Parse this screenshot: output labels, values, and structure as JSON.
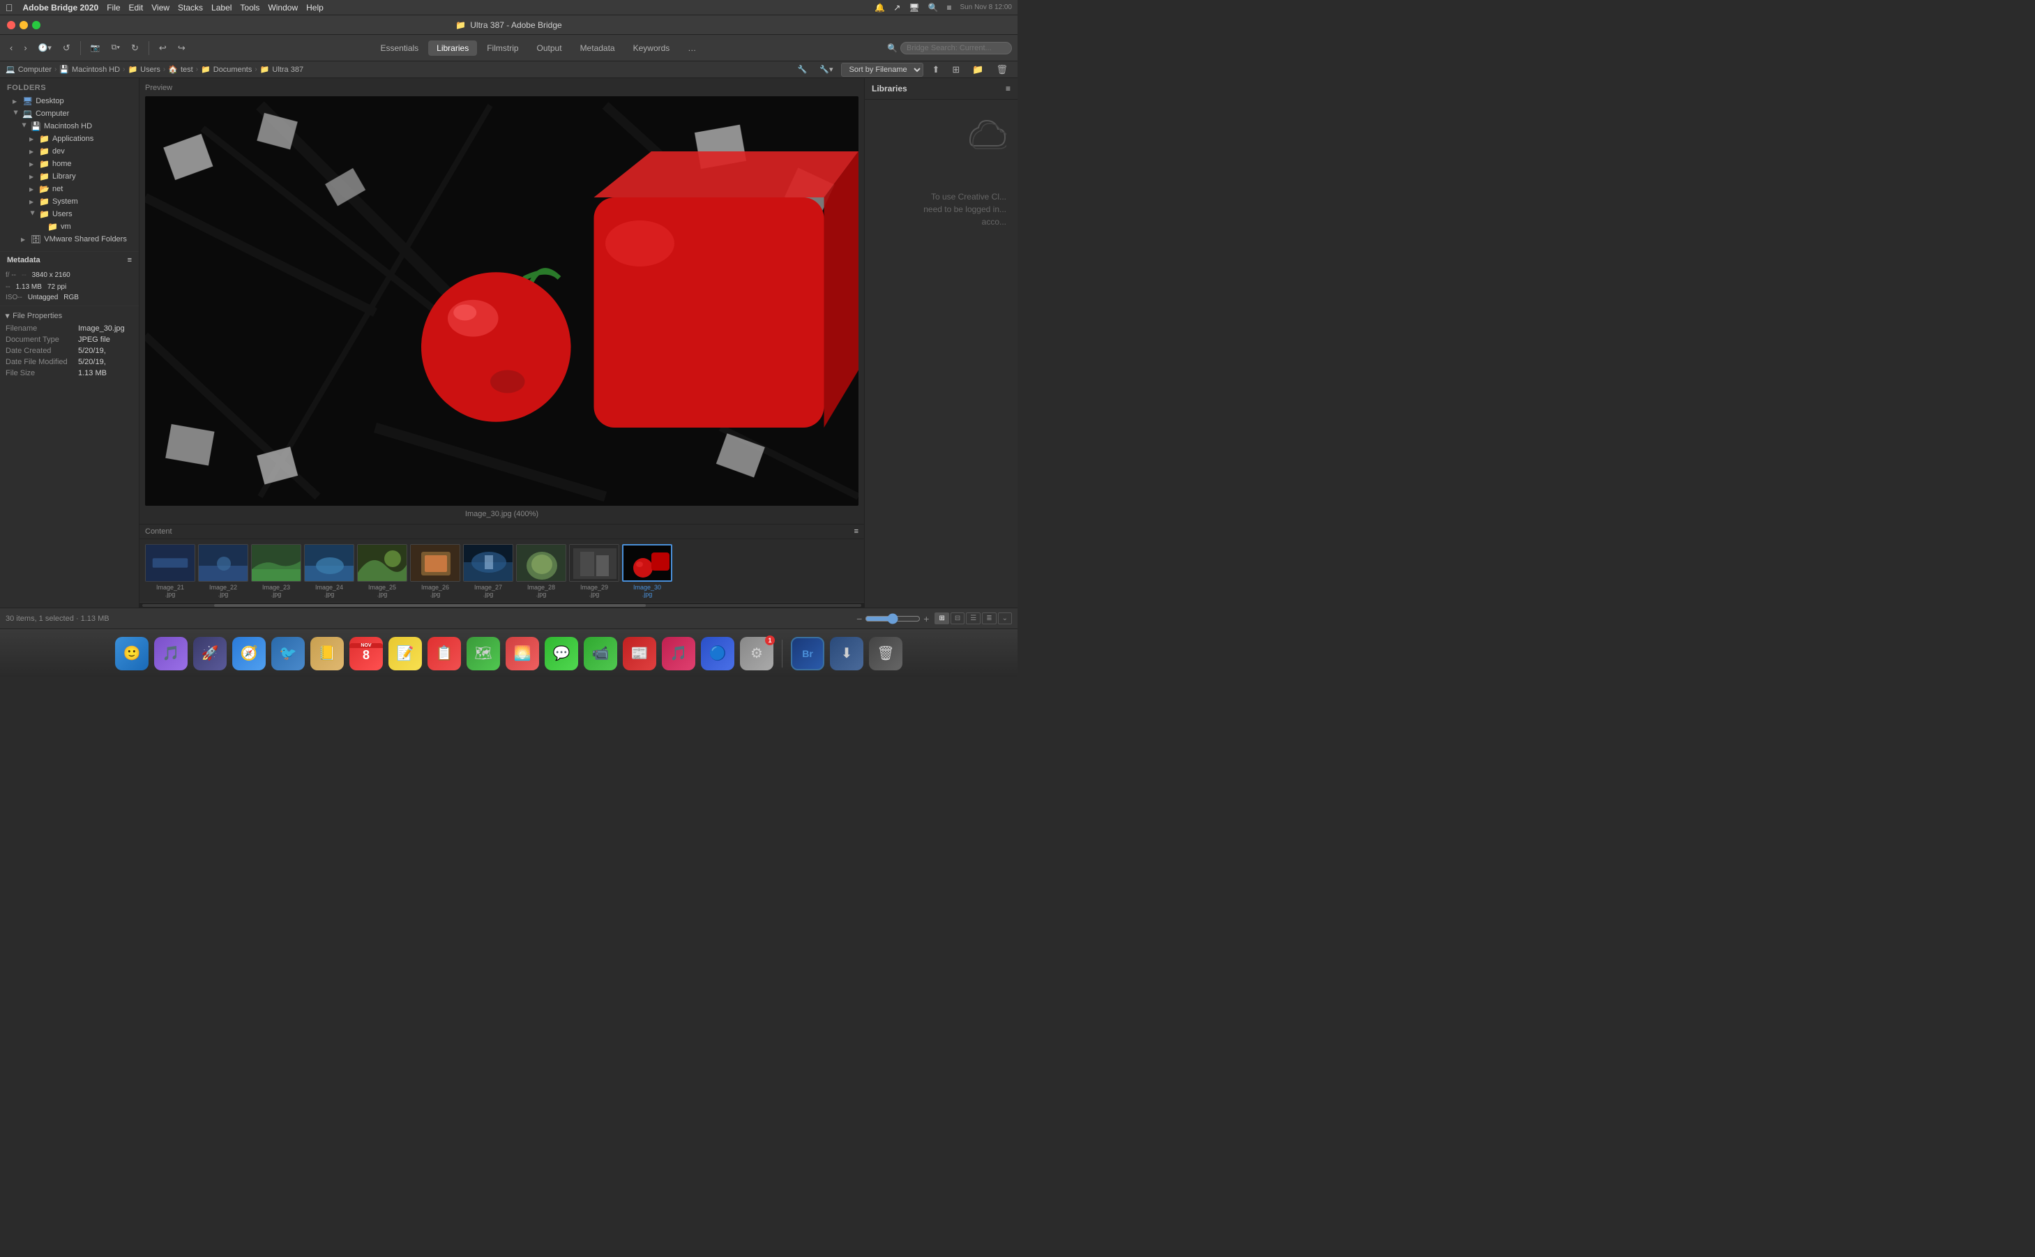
{
  "menubar": {
    "apple": "&#xf8ff;",
    "items": [
      "Adobe Bridge 2020",
      "File",
      "Edit",
      "View",
      "Stacks",
      "Label",
      "Tools",
      "Window",
      "Help"
    ],
    "right_icons": [
      "notification",
      "share",
      "display",
      "search",
      "menu"
    ]
  },
  "titlebar": {
    "title": "Ultra 387 - Adobe Bridge",
    "folder_icon": "📁"
  },
  "toolbar": {
    "back": "‹",
    "forward": "›",
    "history": "🕐",
    "rotate_left": "↺",
    "camera": "📷",
    "copy": "⧉",
    "refresh": "↺",
    "undo": "↩",
    "redo": "↪",
    "nav_tabs": [
      "Essentials",
      "Libraries",
      "Filmstrip",
      "Output",
      "Metadata",
      "Keywords"
    ],
    "active_tab": "Libraries",
    "more_btn": "…",
    "search_placeholder": "Bridge Search: Current..."
  },
  "breadcrumb": {
    "items": [
      {
        "label": "Computer",
        "icon": "💻"
      },
      {
        "label": "Macintosh HD",
        "icon": "💾"
      },
      {
        "label": "Users",
        "icon": "📁"
      },
      {
        "label": "test",
        "icon": "🏠"
      },
      {
        "label": "Documents",
        "icon": "📁"
      },
      {
        "label": "Ultra 387",
        "icon": "📁"
      }
    ],
    "sort_label": "Sort by Filename",
    "sort_icons": [
      "⬆",
      "filter",
      "view1",
      "view2"
    ]
  },
  "sidebar": {
    "section_label": "Folders",
    "tree": [
      {
        "label": "Desktop",
        "icon": "🖥",
        "indent": 1,
        "expanded": false
      },
      {
        "label": "Computer",
        "icon": "💻",
        "indent": 1,
        "expanded": true
      },
      {
        "label": "Macintosh HD",
        "icon": "💾",
        "indent": 2,
        "expanded": true
      },
      {
        "label": "Applications",
        "icon": "📁",
        "indent": 3,
        "expanded": false
      },
      {
        "label": "dev",
        "icon": "📁",
        "indent": 3,
        "expanded": false
      },
      {
        "label": "home",
        "icon": "📁",
        "indent": 3,
        "expanded": false
      },
      {
        "label": "Library",
        "icon": "📁",
        "indent": 3,
        "expanded": false
      },
      {
        "label": "net",
        "icon": "📂",
        "indent": 3,
        "expanded": false
      },
      {
        "label": "System",
        "icon": "📁",
        "indent": 3,
        "expanded": false
      },
      {
        "label": "Users",
        "icon": "📁",
        "indent": 3,
        "expanded": true
      },
      {
        "label": "vm",
        "icon": "📁",
        "indent": 4,
        "expanded": false
      },
      {
        "label": "VMware Shared Folders",
        "icon": "🗄",
        "indent": 2,
        "expanded": false
      }
    ]
  },
  "preview": {
    "label": "Preview",
    "caption": "Image_30.jpg (400%)",
    "image_desc": "red cherry and red cube on black background"
  },
  "metadata_panel": {
    "label": "Metadata",
    "aperture": "f/ --",
    "shutter": "--",
    "iso": "ISO--",
    "blank1": "--",
    "dimensions": "3840 x 2160",
    "file_size": "1.13 MB",
    "ppi": "72 ppi",
    "color_profile": "Untagged",
    "color_mode": "RGB",
    "file_properties_label": "File Properties",
    "filename_key": "Filename",
    "filename_val": "Image_30.jpg",
    "doctype_key": "Document Type",
    "doctype_val": "JPEG file",
    "date_created_key": "Date Created",
    "date_created_val": "5/20/19,",
    "date_modified_key": "Date File Modified",
    "date_modified_val": "5/20/19,",
    "filesize_key": "File Size",
    "filesize_val": "1.13 MB"
  },
  "content": {
    "label": "Content",
    "thumbnails": [
      {
        "label": "Image_21\n.jpg",
        "color": "color-1",
        "selected": false
      },
      {
        "label": "Image_22\n.jpg",
        "color": "color-2",
        "selected": false
      },
      {
        "label": "Image_23\n.jpg",
        "color": "color-3",
        "selected": false
      },
      {
        "label": "Image_24\n.jpg",
        "color": "color-4",
        "selected": false
      },
      {
        "label": "Image_25\n.jpg",
        "color": "color-5",
        "selected": false
      },
      {
        "label": "Image_26\n.jpg",
        "color": "color-6",
        "selected": false
      },
      {
        "label": "Image_27\n.jpg",
        "color": "color-7",
        "selected": false
      },
      {
        "label": "Image_28\n.jpg",
        "color": "color-8",
        "selected": false
      },
      {
        "label": "Image_29\n.jpg",
        "color": "color-8",
        "selected": false
      },
      {
        "label": "Image_30\n.jpg",
        "color": "color-9",
        "selected": true
      }
    ]
  },
  "libraries": {
    "label": "Libraries",
    "message": "To use Creative Cl...\nneed to be logged in...\nacc..."
  },
  "bottom_bar": {
    "count": "30 items, 1 selected · 1.13 MB",
    "zoom_minus": "−",
    "zoom_plus": "+",
    "view_grid_1": "⊞",
    "view_grid_2": "⊟",
    "view_list": "☰",
    "view_detail": "≣",
    "more": "⌄"
  },
  "dock": {
    "items": [
      {
        "name": "finder",
        "emoji": "🙂",
        "color": "#3a8fd8",
        "label": "Finder"
      },
      {
        "name": "siri",
        "emoji": "🎵",
        "color": "#8a5fd8",
        "label": "Siri"
      },
      {
        "name": "launchpad",
        "emoji": "🚀",
        "color": "#555",
        "label": "Launchpad"
      },
      {
        "name": "safari",
        "emoji": "🧭",
        "color": "#5a9fd8",
        "label": "Safari"
      },
      {
        "name": "twitter",
        "emoji": "🐦",
        "color": "#3a8fd8",
        "label": "Tweetbot"
      },
      {
        "name": "contacts",
        "emoji": "📒",
        "color": "#c8a050",
        "label": "Contacts"
      },
      {
        "name": "calendar",
        "emoji": "📅",
        "color": "#c83030",
        "label": "Calendar"
      },
      {
        "name": "notes",
        "emoji": "📝",
        "color": "#f0d060",
        "label": "Notes"
      },
      {
        "name": "reminders",
        "emoji": "📋",
        "color": "#c03030",
        "label": "Reminders"
      },
      {
        "name": "maps",
        "emoji": "🗺",
        "color": "#50a850",
        "label": "Maps"
      },
      {
        "name": "photos",
        "emoji": "🌅",
        "color": "#e05050",
        "label": "Photos"
      },
      {
        "name": "messages",
        "emoji": "💬",
        "color": "#50c850",
        "label": "Messages"
      },
      {
        "name": "facetime",
        "emoji": "📹",
        "color": "#50c850",
        "label": "FaceTime"
      },
      {
        "name": "news",
        "emoji": "📰",
        "color": "#d03030",
        "label": "News"
      },
      {
        "name": "music",
        "emoji": "🎵",
        "color": "#d03060",
        "label": "Music"
      },
      {
        "name": "appstore",
        "emoji": "🔵",
        "color": "#3a6fd8",
        "label": "App Store"
      },
      {
        "name": "systemprefs",
        "emoji": "⚙",
        "color": "#888",
        "label": "System Preferences",
        "badge": "1"
      },
      {
        "name": "bridge",
        "emoji": "Br",
        "color": "#1a4a8a",
        "label": "Adobe Bridge"
      },
      {
        "name": "downloads",
        "emoji": "⬇",
        "color": "#3a6aa0",
        "label": "Downloads"
      },
      {
        "name": "trash",
        "emoji": "🗑",
        "color": "#555",
        "label": "Trash"
      }
    ]
  }
}
